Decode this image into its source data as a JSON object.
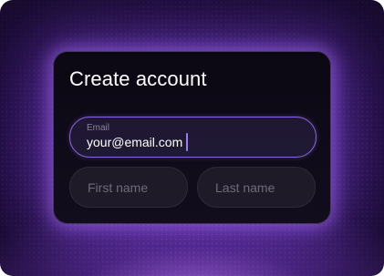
{
  "form": {
    "title": "Create account",
    "email": {
      "label": "Email",
      "value": "your@email.com"
    },
    "first_name": {
      "placeholder": "First name",
      "value": ""
    },
    "last_name": {
      "placeholder": "Last name",
      "value": ""
    }
  },
  "theme": {
    "accent": "#8d66e8",
    "card_background": "#0b0813",
    "glow": "#b07cff"
  }
}
